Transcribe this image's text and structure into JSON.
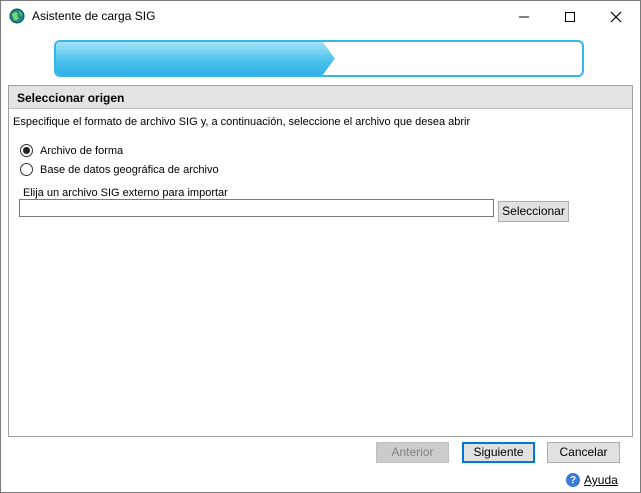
{
  "window": {
    "title": "Asistente de carga SIG",
    "icon": "globe-icon",
    "controls": {
      "minimize": "minimize-icon",
      "maximize": "maximize-icon",
      "close": "close-icon"
    }
  },
  "progress": {
    "fraction": 0.53,
    "color": "#38b6e8"
  },
  "panel": {
    "header": "Seleccionar origen",
    "instruction": "Especifique el formato de archivo SIG y, a continuación, seleccione el archivo que desea abrir",
    "options": [
      {
        "label": "Archivo de forma",
        "selected": true
      },
      {
        "label": "Base de datos geográfica de archivo",
        "selected": false
      }
    ],
    "file_label": "Elija un archivo SIG externo para importar",
    "file_value": "",
    "select_button": "Seleccionar"
  },
  "footer": {
    "prev": "Anterior",
    "next": "Siguiente",
    "cancel": "Cancelar",
    "help": "Ayuda",
    "help_icon": "help-icon"
  }
}
